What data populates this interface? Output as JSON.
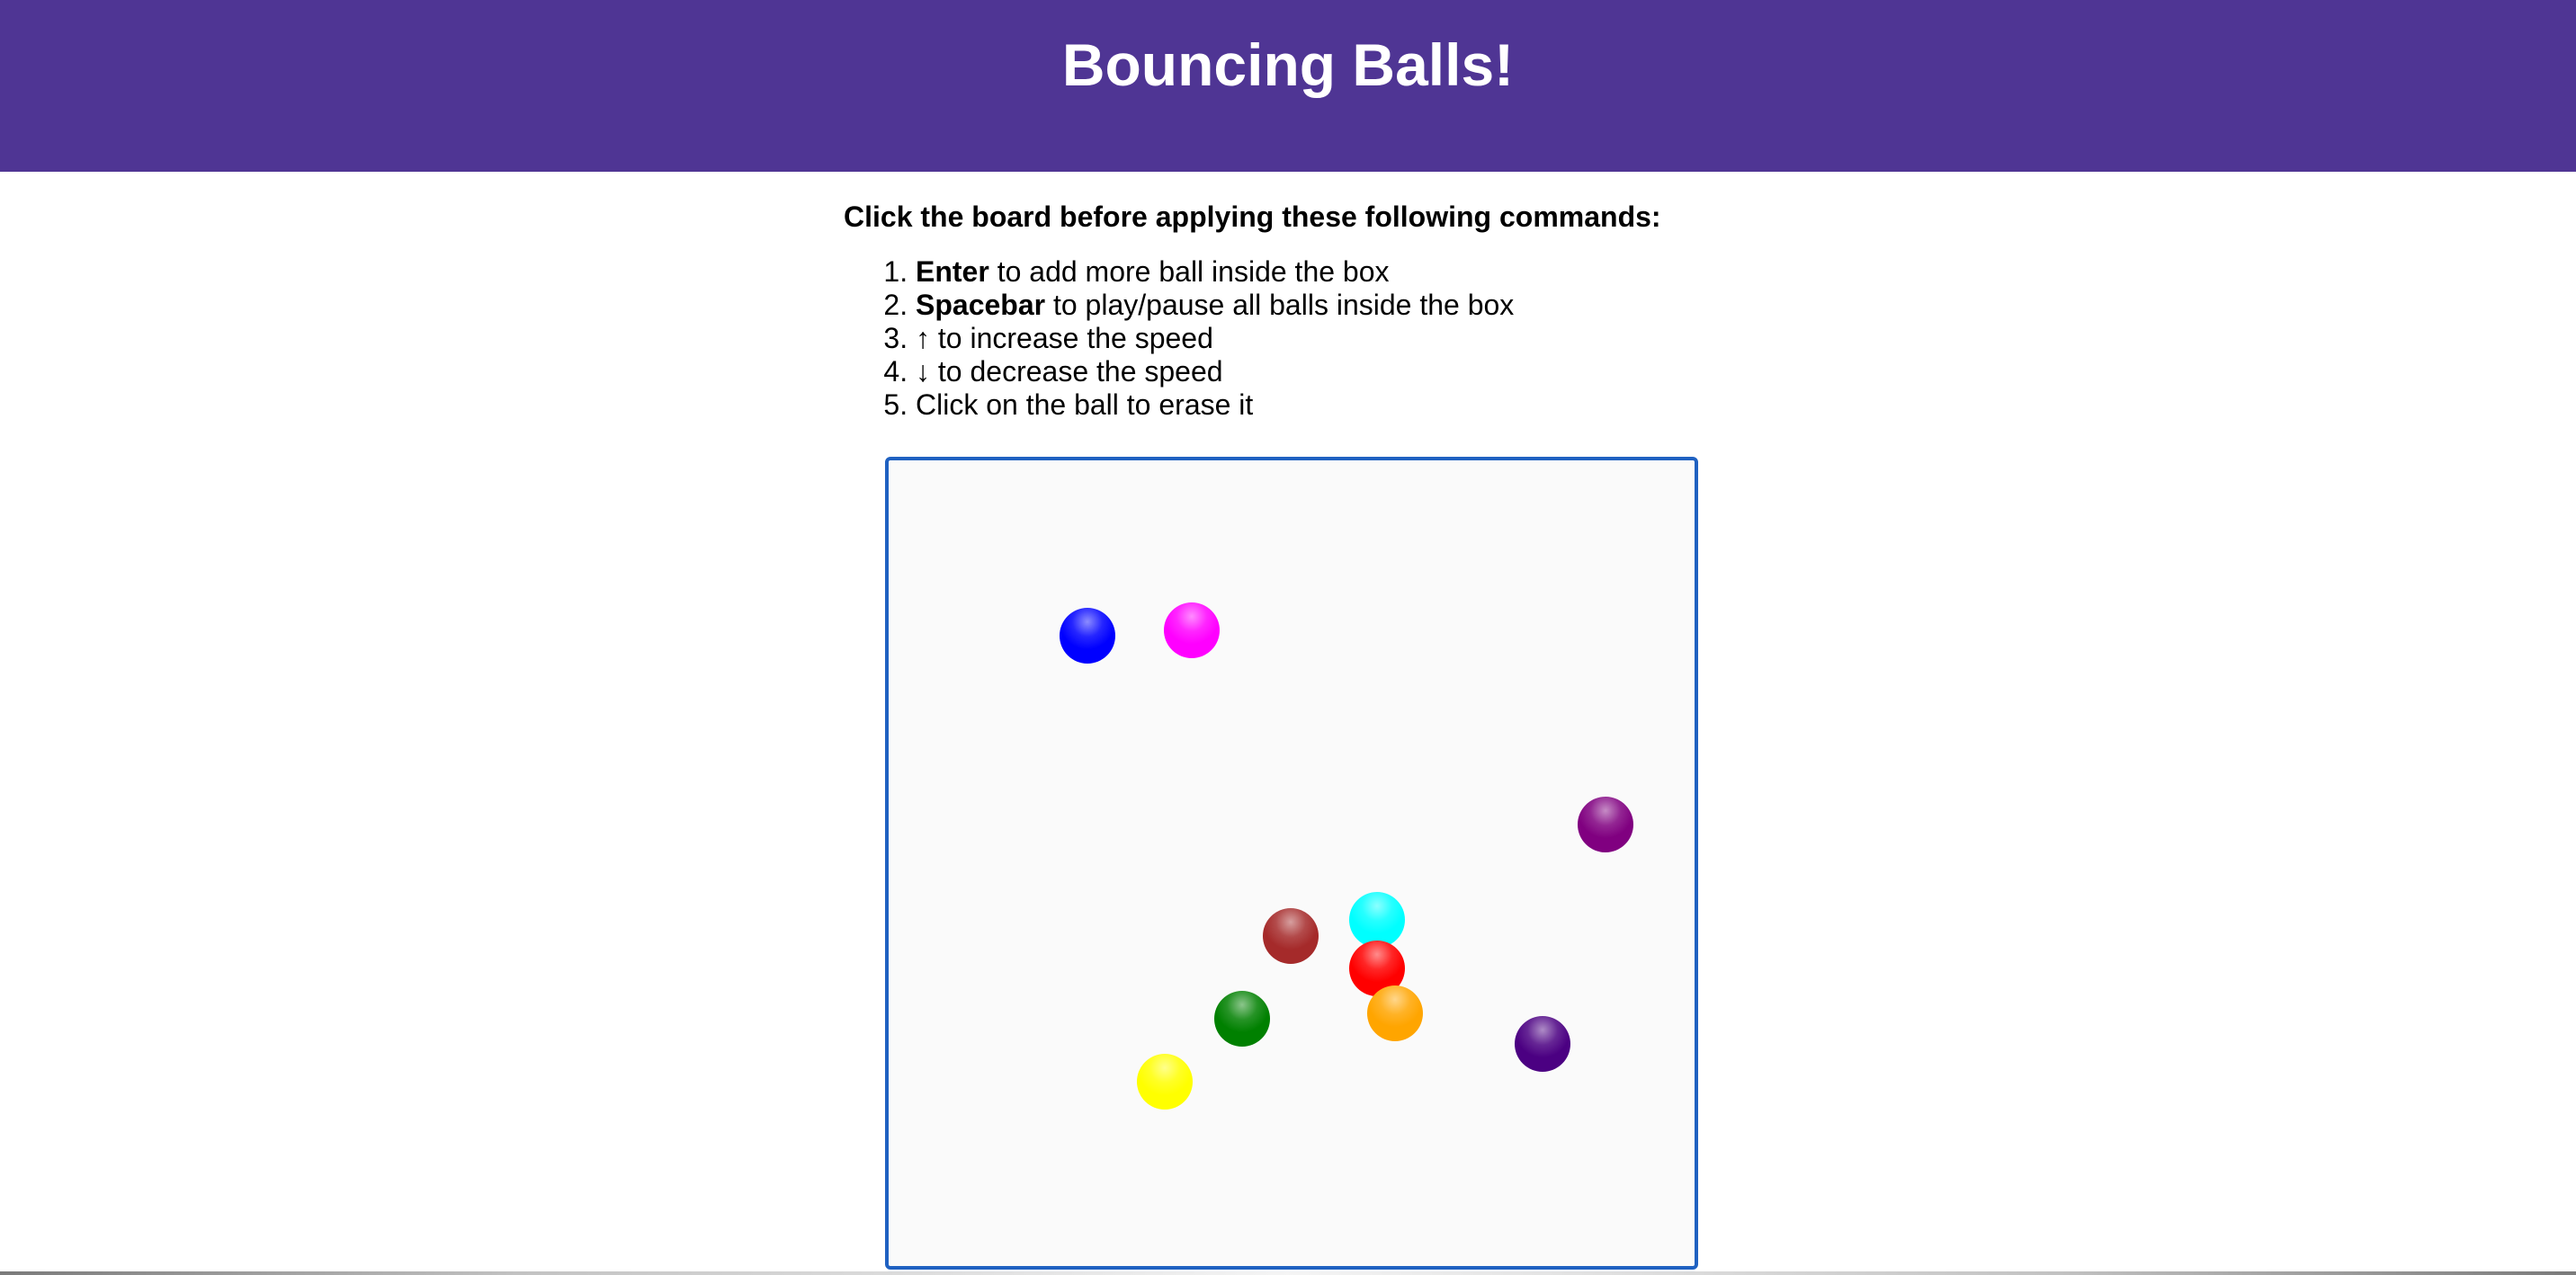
{
  "header": {
    "title": "Bouncing Balls!",
    "background": "#4f3594"
  },
  "instructions": {
    "intro": "Click the board before applying these following commands:",
    "items": [
      {
        "key": "Enter",
        "text": " to add more ball inside the box"
      },
      {
        "key": "Spacebar",
        "text": " to play/pause all balls inside the box"
      },
      {
        "key": "",
        "text": "↑ to increase the speed"
      },
      {
        "key": "",
        "text": "↓ to decrease the speed"
      },
      {
        "key": "",
        "text": "Click on the ball to erase it"
      }
    ]
  },
  "board": {
    "border_color": "#1f61c1",
    "background": "#fafafa",
    "balls": [
      {
        "color": "blue"
      },
      {
        "color": "magenta"
      },
      {
        "color": "purple"
      },
      {
        "color": "cyan"
      },
      {
        "color": "brown"
      },
      {
        "color": "red"
      },
      {
        "color": "orange"
      },
      {
        "color": "green"
      },
      {
        "color": "indigo"
      },
      {
        "color": "yellow"
      }
    ]
  }
}
